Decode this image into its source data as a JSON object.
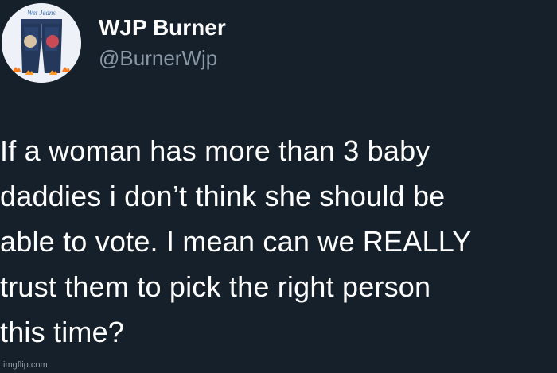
{
  "author": {
    "display_name": "WJP Burner",
    "handle": "@BurnerWjp",
    "avatar_caption": "Wet Jeans",
    "avatar_icon": "jeans-avatar-icon"
  },
  "tweet": {
    "lines": [
      "If a woman has more than 3 baby",
      "daddies i don’t think she should be",
      "able to vote. I mean can we REALLY",
      "trust them to pick the right person",
      "this time?"
    ]
  },
  "watermark": "imgflip.com",
  "colors": {
    "background": "#15202b",
    "text": "#ffffff",
    "handle": "#8b98a5"
  }
}
